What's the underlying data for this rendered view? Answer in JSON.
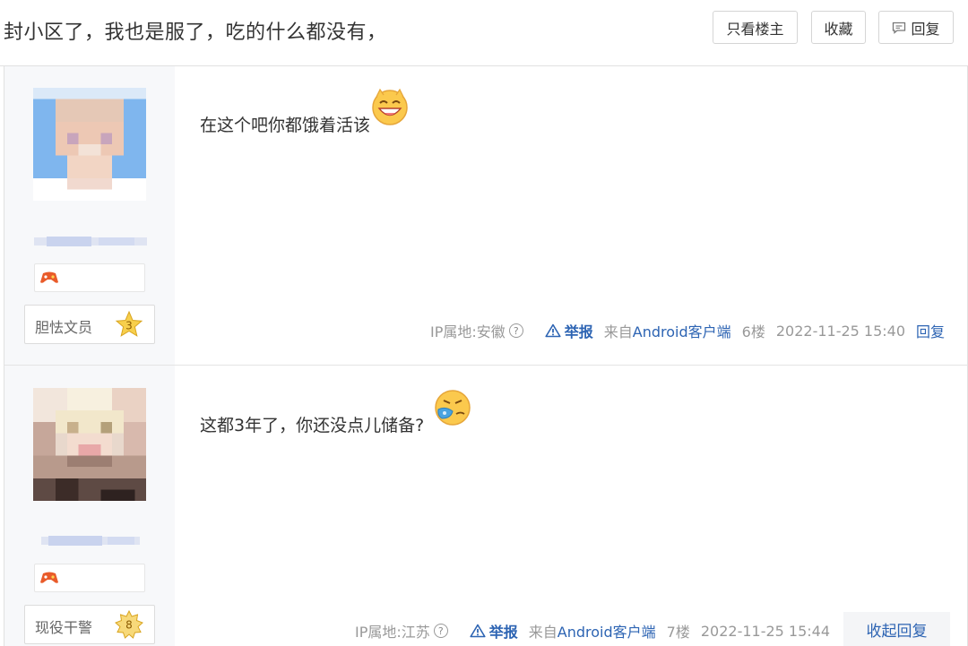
{
  "header": {
    "title": "封小区了，我也是服了，吃的什么都没有，",
    "only_op_label": "只看楼主",
    "favorite_label": "收藏",
    "reply_label": "回复"
  },
  "posts": [
    {
      "content": "在这个吧你都饿着活该",
      "emoji_icon": "laughing-cat-emoji",
      "level_title": "胆怯文员",
      "level_num": "3",
      "ip_location": "IP属地:安徽",
      "report_label": "举报",
      "source_prefix": "来自",
      "source_client": "Android客户端",
      "floor": "6楼",
      "time": "2022-11-25 15:40",
      "reply_label": "回复"
    },
    {
      "content": "这都3年了，你还没点儿储备?",
      "emoji_icon": "sneezing-face-emoji",
      "level_title": "现役干警",
      "level_num": "8",
      "ip_location": "IP属地:江苏",
      "report_label": "举报",
      "source_prefix": "来自",
      "source_client": "Android客户端",
      "floor": "7楼",
      "time": "2022-11-25 15:44",
      "reply_label": "收起回复"
    }
  ],
  "colors": {
    "link_blue": "#2d64b3",
    "meta_gray": "#999999",
    "sidebar_bg": "#f7f8fa",
    "star_gold": "#f5c842"
  }
}
